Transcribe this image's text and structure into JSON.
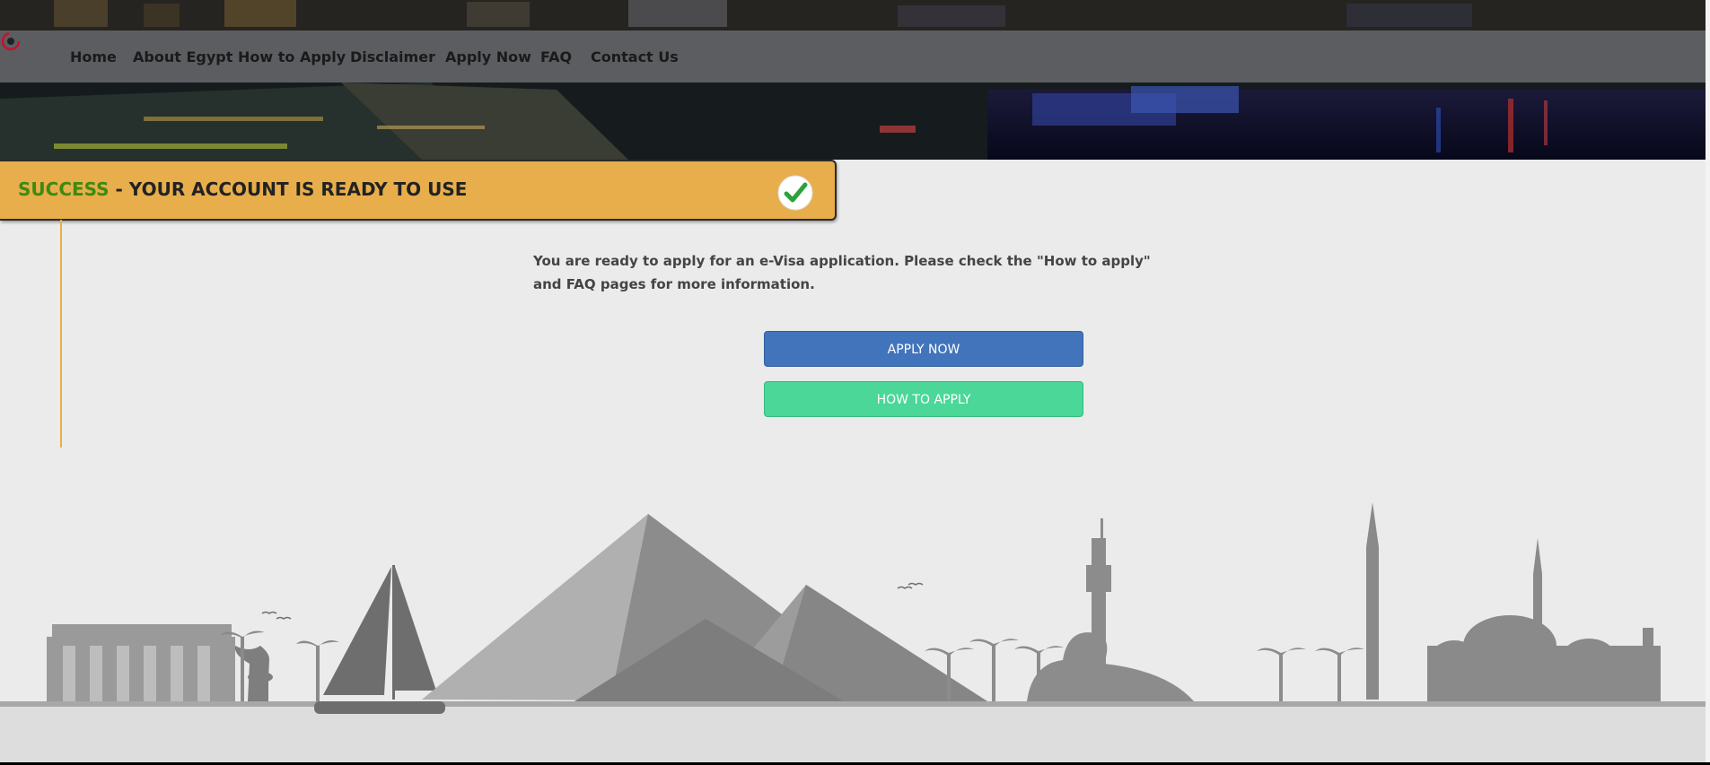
{
  "nav": {
    "logo_icon": "e-visa-logo-icon",
    "items": [
      {
        "label": "Home"
      },
      {
        "label": "About Egypt"
      },
      {
        "label": "How to Apply"
      },
      {
        "label": "Disclaimer"
      },
      {
        "label": "Apply Now"
      },
      {
        "label": "FAQ"
      },
      {
        "label": "Contact Us"
      }
    ]
  },
  "banner": {
    "success_word": "SUCCESS",
    "rest": " - YOUR ACCOUNT IS READY TO USE",
    "icon": "checkmark-icon"
  },
  "message": "You are ready to apply for an e-Visa application. Please check the \"How to apply\" and FAQ pages for more information.",
  "buttons": {
    "apply_now": "APPLY NOW",
    "how_to_apply": "HOW TO APPLY"
  },
  "colors": {
    "banner": "#e8ae4c",
    "success_green": "#3d8a0f",
    "apply_blue": "#4274bb",
    "how_green": "#4ad798",
    "page_bg": "#ebebeb"
  }
}
